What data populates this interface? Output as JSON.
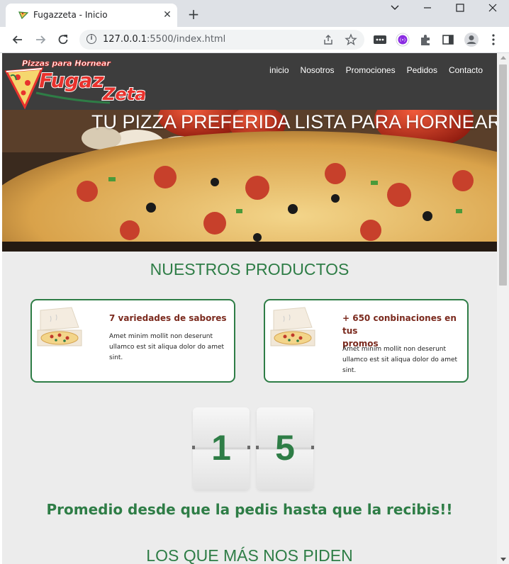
{
  "browser": {
    "tab_title": "Fugazzeta - Inicio",
    "url_host": "127.0.0.1",
    "url_rest": ":5500/index.html",
    "close_glyph": "✕",
    "newtab_glyph": "+",
    "win_min": "—",
    "win_max": "☐",
    "win_close": "✕"
  },
  "site": {
    "logo_top": "Pizzas para Hornear",
    "logo_name": "Fugazzeta",
    "nav": [
      "inicio",
      "Nosotros",
      "Promociones",
      "Pedidos",
      "Contacto"
    ]
  },
  "hero": {
    "title": "TU PIZZA PREFERIDA LISTA PARA HORNEAR"
  },
  "products": {
    "title": "NUESTROS PRODUCTOS",
    "cards": [
      {
        "title": "7 variedades de sabores",
        "text": [
          "Amet minim mollit non deserunt",
          "ullamco est sit aliqua dolor do amet",
          "sint."
        ]
      },
      {
        "title": "+ 650 conbinaciones en tus",
        "title2": "promos",
        "text": [
          "Amet minim mollit non deserunt",
          "ullamco est sit aliqua dolor do amet",
          "sint."
        ]
      }
    ]
  },
  "counter": {
    "digits": [
      "1",
      "5"
    ],
    "caption": "Promedio desde que la pedis hasta que la recibis!!"
  },
  "popular": {
    "title": "LOS QUE MÁS NOS PIDEN"
  },
  "colors": {
    "brand_green": "#2e7d46",
    "header_bg": "#3d3d3d",
    "card_title": "#7b2a1e"
  }
}
